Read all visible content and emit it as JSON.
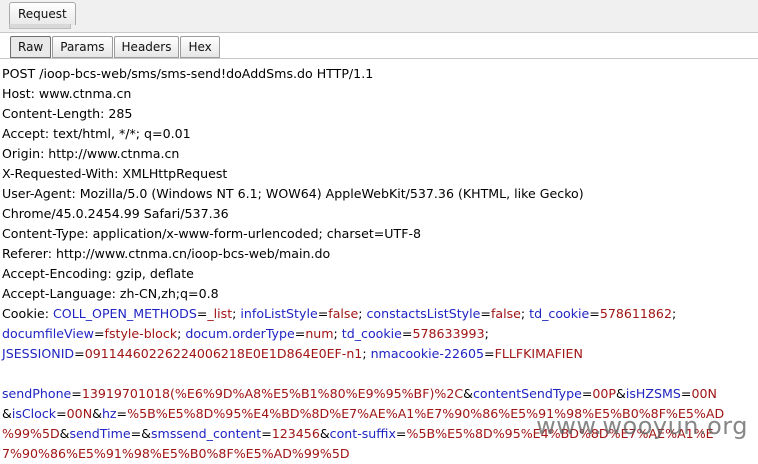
{
  "top_tab": "Request",
  "sub_tabs": [
    "Raw",
    "Params",
    "Headers",
    "Hex"
  ],
  "headers": [
    "POST /ioop-bcs-web/sms/sms-send!doAddSms.do HTTP/1.1",
    "Host: www.ctnma.cn",
    "Content-Length: 285",
    "Accept: text/html, */*; q=0.01",
    "Origin: http://www.ctnma.cn",
    "X-Requested-With: XMLHttpRequest",
    "User-Agent: Mozilla/5.0 (Windows NT 6.1; WOW64) AppleWebKit/537.36 (KHTML, like Gecko)",
    "Chrome/45.0.2454.99 Safari/537.36",
    "Content-Type: application/x-www-form-urlencoded; charset=UTF-8",
    "Referer: http://www.ctnma.cn/ioop-bcs-web/main.do",
    "Accept-Encoding: gzip, deflate",
    "Accept-Language: zh-CN,zh;q=0.8"
  ],
  "cookie_lines": [
    [
      {
        "t": "Cookie: ",
        "c": "b"
      },
      {
        "t": "COLL_OPEN_METHODS",
        "c": "k"
      },
      {
        "t": "=",
        "c": "b"
      },
      {
        "t": "_list",
        "c": "v"
      },
      {
        "t": "; ",
        "c": "b"
      },
      {
        "t": "infoListStyle",
        "c": "k"
      },
      {
        "t": "=",
        "c": "b"
      },
      {
        "t": "false",
        "c": "v"
      },
      {
        "t": "; ",
        "c": "b"
      },
      {
        "t": "constactsListStyle",
        "c": "k"
      },
      {
        "t": "=",
        "c": "b"
      },
      {
        "t": "false",
        "c": "v"
      },
      {
        "t": "; ",
        "c": "b"
      },
      {
        "t": "td_cookie",
        "c": "k"
      },
      {
        "t": "=",
        "c": "b"
      },
      {
        "t": "578611862",
        "c": "v"
      },
      {
        "t": ";",
        "c": "b"
      }
    ],
    [
      {
        "t": "documfileView",
        "c": "k"
      },
      {
        "t": "=",
        "c": "b"
      },
      {
        "t": "fstyle-block",
        "c": "v"
      },
      {
        "t": "; ",
        "c": "b"
      },
      {
        "t": "docum.orderType",
        "c": "k"
      },
      {
        "t": "=",
        "c": "b"
      },
      {
        "t": "num",
        "c": "v"
      },
      {
        "t": "; ",
        "c": "b"
      },
      {
        "t": "td_cookie",
        "c": "k"
      },
      {
        "t": "=",
        "c": "b"
      },
      {
        "t": "578633993",
        "c": "v"
      },
      {
        "t": ";",
        "c": "b"
      }
    ],
    [
      {
        "t": "JSESSIONID",
        "c": "k"
      },
      {
        "t": "=",
        "c": "b"
      },
      {
        "t": "09114460226224006218E0E1D864E0EF-n1",
        "c": "v"
      },
      {
        "t": "; ",
        "c": "b"
      },
      {
        "t": "nmacookie-22605",
        "c": "k"
      },
      {
        "t": "=",
        "c": "b"
      },
      {
        "t": "FLLFKIMAFIEN",
        "c": "v"
      }
    ]
  ],
  "body_lines": [
    [
      {
        "t": "sendPhone",
        "c": "k"
      },
      {
        "t": "=",
        "c": "b"
      },
      {
        "t": "13919701018(%E6%9D%A8%E5%B1%80%E9%95%BF)%2C",
        "c": "v"
      },
      {
        "t": "&",
        "c": "b"
      },
      {
        "t": "contentSendType",
        "c": "k"
      },
      {
        "t": "=",
        "c": "b"
      },
      {
        "t": "00P",
        "c": "v"
      },
      {
        "t": "&",
        "c": "b"
      },
      {
        "t": "isHZSMS",
        "c": "k"
      },
      {
        "t": "=",
        "c": "b"
      },
      {
        "t": "00N",
        "c": "v"
      }
    ],
    [
      {
        "t": "&",
        "c": "b"
      },
      {
        "t": "isClock",
        "c": "k"
      },
      {
        "t": "=",
        "c": "b"
      },
      {
        "t": "00N",
        "c": "v"
      },
      {
        "t": "&",
        "c": "b"
      },
      {
        "t": "hz",
        "c": "k"
      },
      {
        "t": "=",
        "c": "b"
      },
      {
        "t": "%5B%E5%8D%95%E4%BD%8D%E7%AE%A1%E7%90%86%E5%91%98%E5%B0%8F%E5%AD",
        "c": "v"
      }
    ],
    [
      {
        "t": "%99%5D",
        "c": "v"
      },
      {
        "t": "&",
        "c": "b"
      },
      {
        "t": "sendTime",
        "c": "k"
      },
      {
        "t": "=&",
        "c": "b"
      },
      {
        "t": "smssend_content",
        "c": "k"
      },
      {
        "t": "=",
        "c": "b"
      },
      {
        "t": "123456",
        "c": "v"
      },
      {
        "t": "&",
        "c": "b"
      },
      {
        "t": "cont-suffix",
        "c": "k"
      },
      {
        "t": "=",
        "c": "b"
      },
      {
        "t": "%5B%E5%8D%95%E4%BD%8D%E7%AE%A1%E",
        "c": "v"
      }
    ],
    [
      {
        "t": "7%90%86%E5%91%98%E5%B0%8F%E5%AD%99%5D",
        "c": "v"
      }
    ]
  ],
  "watermark": "www.wooyun.org"
}
